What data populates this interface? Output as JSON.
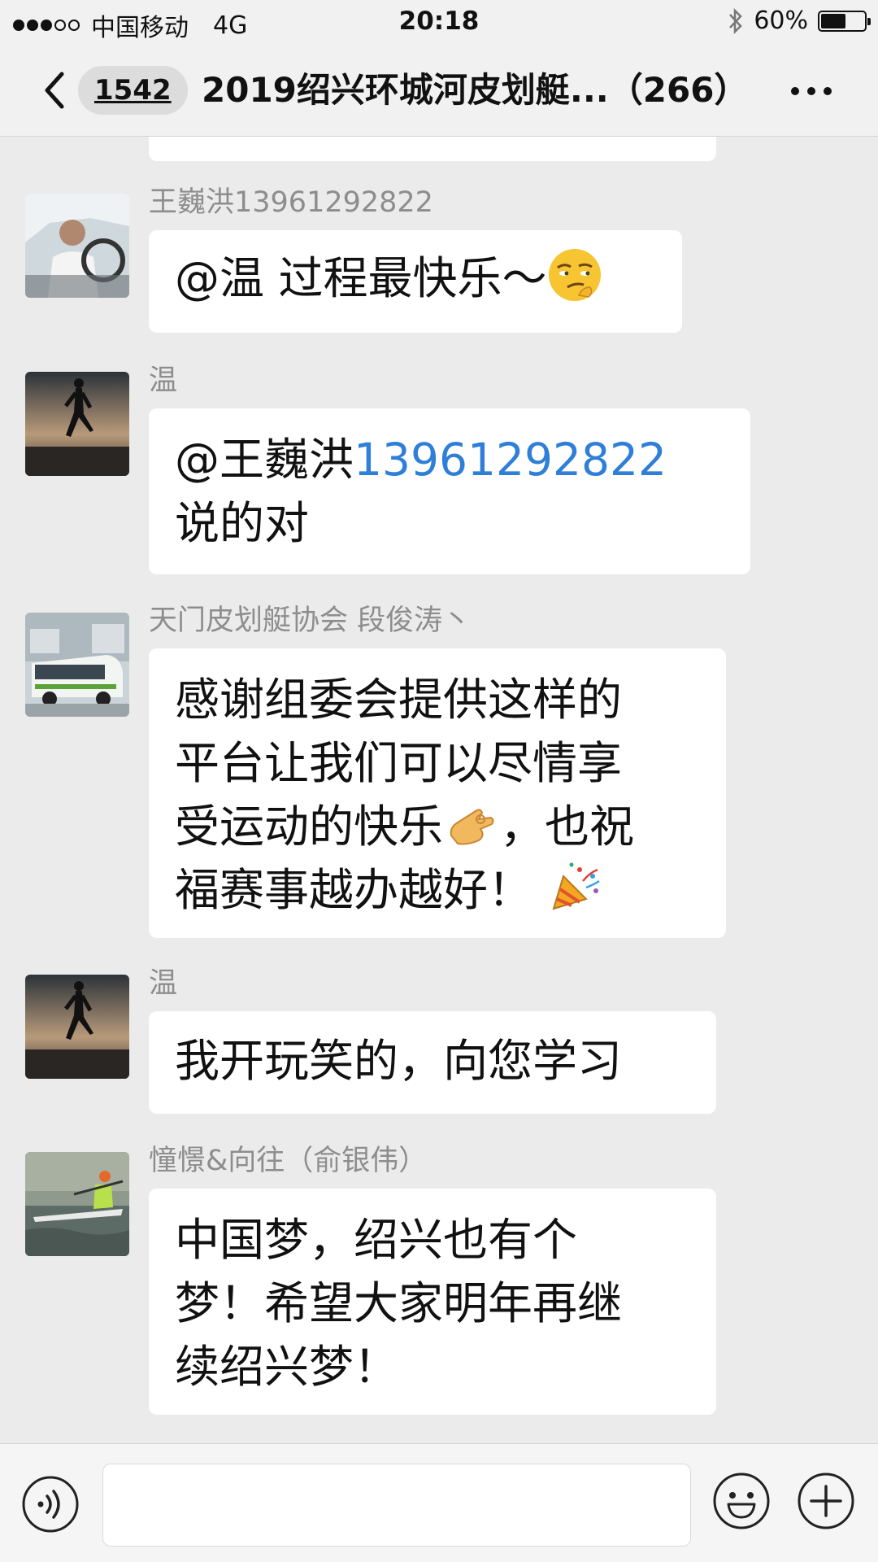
{
  "status_bar": {
    "carrier": "中国移动",
    "network": "4G",
    "time": "20:18",
    "battery": "60%",
    "battery_level": 0.6,
    "signal_bars_filled": 3,
    "signal_bars_total": 5
  },
  "nav": {
    "unread_count": "1542",
    "title": "2019绍兴环城河皮划艇...（266）"
  },
  "messages": [
    {
      "sender": "王巍洪13961292822",
      "avatar": "driver-avatar",
      "text": "@温 过程最快乐～",
      "emoji": "smirking-face-emoji"
    },
    {
      "sender": "温",
      "avatar": "runner-silhouette-avatar",
      "line1_prefix": "@王巍洪",
      "line1_number": "13961292822",
      "line2": "说的对"
    },
    {
      "sender": "天门皮划艇协会 段俊涛丶",
      "avatar": "van-avatar",
      "line1": "感谢组委会提供这样的",
      "line2": "平台让我们可以尽情享",
      "line3_a": "受运动的快乐",
      "line3_emoji": "ok-hand-emoji",
      "line3_b": "，也祝",
      "line4_a": "福赛事越办越好！",
      "line4_emoji": "party-popper-emoji"
    },
    {
      "sender": "温",
      "avatar": "runner-silhouette-avatar",
      "text": "我开玩笑的，向您学习"
    },
    {
      "sender": "憧憬&向往（俞银伟）",
      "avatar": "kayaker-avatar",
      "line1": "中国梦，绍兴也有个",
      "line2": "梦！希望大家明年再继",
      "line3": "续绍兴梦！"
    }
  ],
  "input_bar": {
    "placeholder": "",
    "icons": [
      "voice-icon",
      "emoji-face-icon",
      "plus-icon"
    ]
  },
  "colors": {
    "background": "#ebebeb",
    "bubble": "#ffffff",
    "mention_link": "#2f7fd8",
    "sender_name": "#8d8d8d"
  }
}
